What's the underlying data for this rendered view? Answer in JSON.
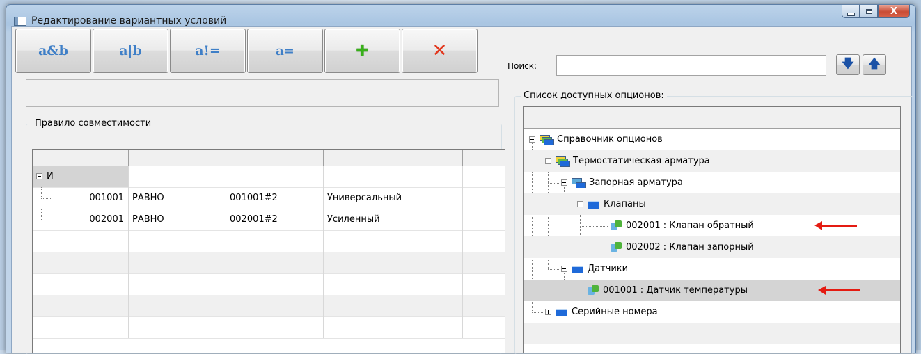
{
  "window": {
    "title": "Редактирование вариантных условий",
    "close_glyph": "X"
  },
  "toolbar": {
    "buttons": [
      {
        "label": "a&b",
        "name": "and-button"
      },
      {
        "label": "a|b",
        "name": "or-button"
      },
      {
        "label": "a!=",
        "name": "not-equal-button"
      },
      {
        "label": "a=",
        "name": "equal-button"
      },
      {
        "label": "✚",
        "name": "add-button",
        "icon": "plus-icon"
      },
      {
        "label": "✕",
        "name": "delete-button",
        "icon": "delete-x-icon"
      }
    ]
  },
  "rule": {
    "group_title": "Правило совместимости",
    "root_label": "И",
    "rows": [
      {
        "code": "001001",
        "op": "РАВНО",
        "value": "001001#2",
        "desc": "Универсальный"
      },
      {
        "code": "002001",
        "op": "РАВНО",
        "value": "002001#2",
        "desc": "Усиленный"
      }
    ]
  },
  "search": {
    "label": "Поиск:",
    "value": "",
    "down_glyph": "🡇",
    "up_glyph": "🡅"
  },
  "options": {
    "group_title": "Список доступных опционов:",
    "tree": [
      {
        "label": "Справочник опционов"
      },
      {
        "label": "Термостатическая арматура"
      },
      {
        "label": "Запорная арматура"
      },
      {
        "label": "Клапаны"
      },
      {
        "label": "002001 : Клапан обратный"
      },
      {
        "label": "002002 : Клапан запорный"
      },
      {
        "label": "Датчики"
      },
      {
        "label": "001001 : Датчик температуры"
      },
      {
        "label": "Серийные номера"
      }
    ]
  },
  "colors": {
    "accent": "#3f7fc7",
    "highlight_arrow": "#e41b12",
    "add_green": "#38b01a"
  }
}
